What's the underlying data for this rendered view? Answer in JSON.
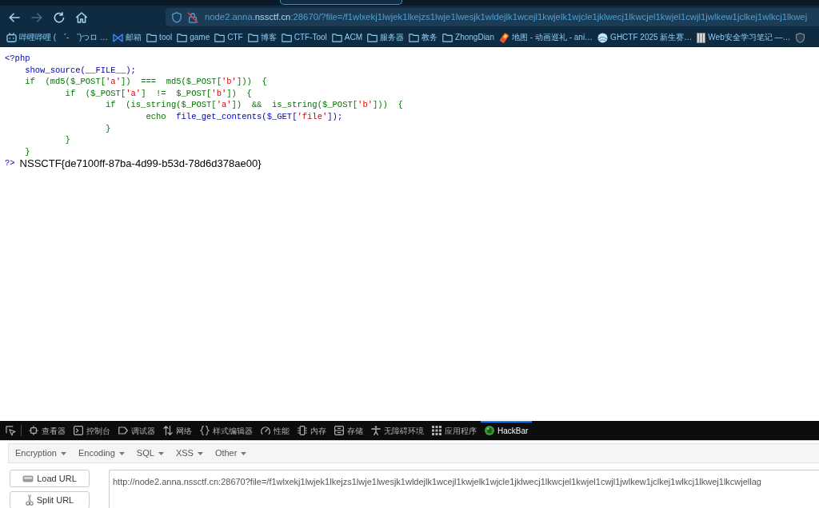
{
  "nav_buttons": [
    {
      "kind": "back",
      "disabled": false
    },
    {
      "kind": "forward",
      "disabled": true
    },
    {
      "kind": "reload",
      "disabled": false
    },
    {
      "kind": "home",
      "disabled": false
    }
  ],
  "address_bar": {
    "insecure": true,
    "host": "node2.anna.",
    "domain": "nssctf.cn",
    "path": ":28670/?file=/f1wlxekj1lwjek1lkejzs1lwje1lwesjk1wldejlk1wcejl1kwjelk1wjcle1jklwecj1lkwcjel1kwjel1cwjl1jwlkew1jclkej1wlkcj1lkwej"
  },
  "bookmarks": [
    {
      "kind": "tv",
      "label": "哔哩哔哩 ( ゜- ゜)つロ …"
    },
    {
      "kind": "mail",
      "label": "邮箱"
    },
    {
      "kind": "folder",
      "label": "tool"
    },
    {
      "kind": "folder",
      "label": "game"
    },
    {
      "kind": "folder",
      "label": "CTF"
    },
    {
      "kind": "folder",
      "label": "博客"
    },
    {
      "kind": "folder",
      "label": "CTF-Tool"
    },
    {
      "kind": "folder",
      "label": "ACM"
    },
    {
      "kind": "folder",
      "label": "服务器"
    },
    {
      "kind": "folder",
      "label": "教务"
    },
    {
      "kind": "folder",
      "label": "ZhongDian"
    },
    {
      "kind": "map",
      "label": "地图 - 动画巡礼 - ani…"
    },
    {
      "kind": "globe",
      "label": "GHCTF 2025 新生赛…"
    },
    {
      "kind": "book",
      "label": "Web安全学习笔记 —…"
    },
    {
      "kind": "shield"
    }
  ],
  "source": {
    "lines": [
      {
        "tokens": [
          {
            "text": "<?php",
            "kind": "default"
          }
        ],
        "children": [
          {
            "tokens": [
              {
                "text": "show_source(__FILE__);",
                "kind": "default"
              }
            ]
          },
          {
            "tokens": [
              {
                "text": "if  (md5($_POST[",
                "kind": "keyword"
              },
              {
                "text": "'a'",
                "kind": "string"
              },
              {
                "text": "])  ===  md5($_POST[",
                "kind": "keyword"
              },
              {
                "text": "'b'",
                "kind": "string"
              },
              {
                "text": "]))  {",
                "kind": "keyword"
              }
            ],
            "children": [
              {
                "tokens": [
                  {
                    "text": "if  ($_POST[",
                    "kind": "keyword"
                  },
                  {
                    "text": "'a'",
                    "kind": "string"
                  },
                  {
                    "text": "]  !=  $_POST[",
                    "kind": "keyword"
                  },
                  {
                    "text": "'b'",
                    "kind": "string"
                  },
                  {
                    "text": "])  {",
                    "kind": "keyword"
                  }
                ],
                "children": [
                  {
                    "tokens": [
                      {
                        "text": "if  (is_string($_POST[",
                        "kind": "keyword"
                      },
                      {
                        "text": "'a'",
                        "kind": "string"
                      },
                      {
                        "text": "])  &&  is_string($_POST[",
                        "kind": "keyword"
                      },
                      {
                        "text": "'b'",
                        "kind": "string"
                      },
                      {
                        "text": "]))  {",
                        "kind": "keyword"
                      }
                    ],
                    "children": [
                      {
                        "tokens": [
                          {
                            "text": "echo  ",
                            "kind": "keyword"
                          },
                          {
                            "text": "file_get_contents($_GET[",
                            "kind": "default"
                          },
                          {
                            "text": "'file'",
                            "kind": "string"
                          },
                          {
                            "text": "]);",
                            "kind": "default"
                          }
                        ]
                      }
                    ]
                  },
                  {
                    "tokens": [
                      {
                        "text": "}",
                        "kind": "keyword"
                      }
                    ]
                  }
                ]
              },
              {
                "tokens": [
                  {
                    "text": "}",
                    "kind": "keyword"
                  }
                ]
              }
            ]
          },
          {
            "tokens": [
              {
                "text": "}",
                "kind": "keyword"
              }
            ]
          }
        ]
      }
    ],
    "closing_tag": "?>",
    "output": "NSSCTF{de7100ff-87ba-4d99-b53d-78d6d378ae00}"
  },
  "devtools": {
    "tabs": [
      {
        "kind": "inspector",
        "label": "查看器",
        "selected": false
      },
      {
        "kind": "console",
        "label": "控制台",
        "selected": false
      },
      {
        "kind": "debugger",
        "label": "调试器",
        "selected": false
      },
      {
        "kind": "network",
        "label": "网络",
        "selected": false
      },
      {
        "kind": "style",
        "label": "样式编辑器",
        "selected": false
      },
      {
        "kind": "performance",
        "label": "性能",
        "selected": false
      },
      {
        "kind": "memory",
        "label": "内存",
        "selected": false
      },
      {
        "kind": "storage",
        "label": "存储",
        "selected": false
      },
      {
        "kind": "accessibility",
        "label": "无障碍环境",
        "selected": false
      },
      {
        "kind": "application",
        "label": "应用程序",
        "selected": false
      },
      {
        "kind": "hackbar",
        "label": "HackBar",
        "selected": true
      }
    ]
  },
  "hackbar": {
    "menus": [
      "Encryption",
      "Encoding",
      "SQL",
      "XSS",
      "Other"
    ],
    "buttons": [
      {
        "kind": "load",
        "label": "Load URL"
      },
      {
        "kind": "split",
        "label": "Split URL"
      }
    ],
    "url": "http://node2.anna.nssctf.cn:28670?file=/f1wlxekj1lwjek1lkejzs1lwje1lwesjk1wldejlk1wcejl1kwjelk1wjcle1jklwecj1lkwcjel1kwjel1cwjl1jwlkew1jclkej1wlkcj1lkwej1lkcwjellag"
  }
}
